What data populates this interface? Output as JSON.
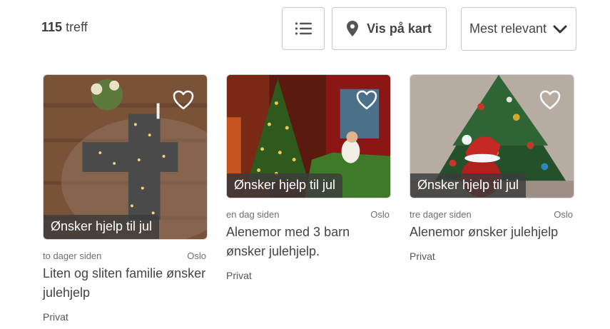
{
  "results": {
    "count": "115",
    "label": "treff"
  },
  "toolbar": {
    "list_view_icon": "list-icon",
    "map_label": "Vis på kart",
    "map_icon": "map-pin-icon",
    "sort_label": "Mest relevant",
    "sort_icon": "chevron-down-icon"
  },
  "listings": [
    {
      "badge": "Ønsker hjelp til jul",
      "age": "to dager siden",
      "location": "Oslo",
      "title": "Liten og sliten familie ønsker julehjelp",
      "seller": "Privat"
    },
    {
      "badge": "Ønsker hjelp til jul",
      "age": "en dag siden",
      "location": "Oslo",
      "title": "Alenemor med 3 barn ønsker julehjelp.",
      "seller": "Privat"
    },
    {
      "badge": "Ønsker hjelp til jul",
      "age": "tre dager siden",
      "location": "Oslo",
      "title": "Alenemor ønsker julehjelp",
      "seller": "Privat"
    }
  ],
  "colors": {
    "text": "#444444",
    "muted": "#6e6e73",
    "border": "#c8c8cc",
    "badge_bg": "#3c3c3c"
  }
}
